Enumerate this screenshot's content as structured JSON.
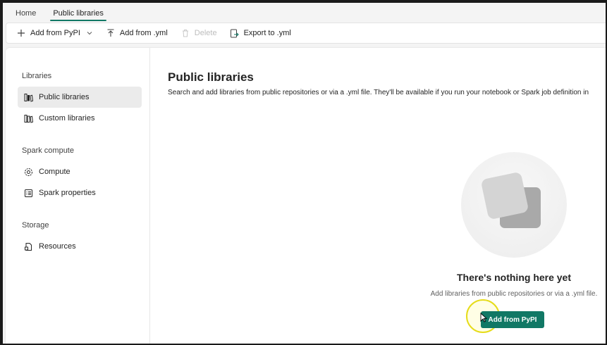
{
  "tabs": [
    {
      "label": "Home",
      "active": false
    },
    {
      "label": "Public libraries",
      "active": true
    }
  ],
  "toolbar": {
    "add_pypi": "Add from PyPI",
    "add_yml": "Add from .yml",
    "delete": "Delete",
    "export": "Export to .yml"
  },
  "sidebar": {
    "libraries_title": "Libraries",
    "public_libraries": "Public libraries",
    "custom_libraries": "Custom libraries",
    "spark_compute_title": "Spark compute",
    "compute": "Compute",
    "spark_properties": "Spark properties",
    "storage_title": "Storage",
    "resources": "Resources"
  },
  "main": {
    "title": "Public libraries",
    "description": "Search and add libraries from public repositories or via a .yml file. They'll be available if you run your notebook or Spark job definition in",
    "empty_title": "There's nothing here yet",
    "empty_desc": "Add libraries from public repositories or via a .yml file.",
    "cta": "Add from PyPI"
  },
  "colors": {
    "accent": "#117865",
    "cursor_highlight": "#e6dc1a"
  }
}
